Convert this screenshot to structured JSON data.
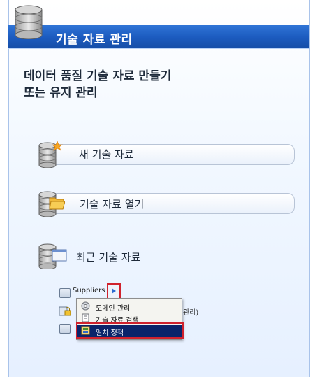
{
  "header": {
    "title": "기술 자료 관리"
  },
  "headline": {
    "line1": "데이터 품질 기술 자료 만들기",
    "line2": "또는 유지 관리"
  },
  "actions": {
    "new_kb": "새 기술 자료",
    "open_kb": "기술 자료 열기",
    "recent_kb": "최근 기술 자료"
  },
  "recent": {
    "items": [
      {
        "label": "Suppliers"
      },
      {
        "label": "관리)"
      }
    ]
  },
  "context_menu": {
    "items": [
      {
        "label": "도메인 관리",
        "icon": "domain-management-icon"
      },
      {
        "label": "기술 자료 검색",
        "icon": "knowledge-discovery-icon"
      },
      {
        "label": "일치 정책",
        "icon": "matching-policy-icon",
        "selected": true
      }
    ]
  },
  "colors": {
    "header_blue": "#1c5bbf",
    "highlight_red": "#d0222d",
    "menu_selected": "#0a246a"
  }
}
